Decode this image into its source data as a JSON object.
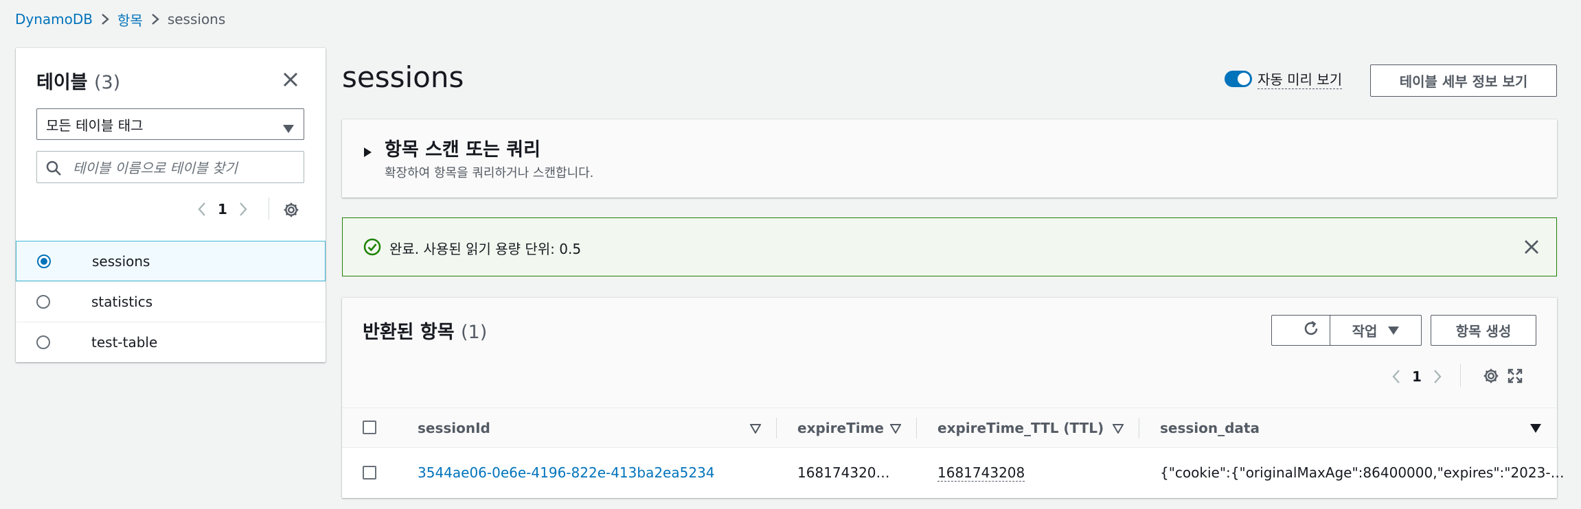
{
  "breadcrumb": {
    "root": "DynamoDB",
    "items": "항목",
    "current": "sessions"
  },
  "left_panel": {
    "title": "테이블",
    "count": "(3)",
    "tag_filter": "모든 테이블 태그",
    "search_placeholder": "테이블 이름으로 테이블 찾기",
    "page": "1",
    "tables": [
      {
        "name": "sessions",
        "selected": true
      },
      {
        "name": "statistics",
        "selected": false
      },
      {
        "name": "test-table",
        "selected": false
      }
    ]
  },
  "main": {
    "title": "sessions",
    "auto_preview_label": "자동 미리 보기",
    "details_button": "테이블 세부 정보 보기",
    "scan": {
      "title": "항목 스캔 또는 쿼리",
      "subtitle": "확장하여 항목을 쿼리하거나 스캔합니다."
    },
    "flash": {
      "message": "완료. 사용된 읽기 용량 단위: 0.5"
    },
    "results": {
      "title": "반환된 항목",
      "count": "(1)",
      "actions_button": "작업",
      "create_button": "항목 생성",
      "page": "1",
      "columns": [
        "sessionId",
        "expireTime",
        "expireTime_TTL (TTL)",
        "session_data"
      ],
      "rows": [
        {
          "sessionId": "3544ae06-0e6e-4196-822e-413ba2ea5234",
          "expireTime": "168174320…",
          "expireTime_TTL": "1681743208",
          "session_data": "{\"cookie\":{\"originalMaxAge\":86400000,\"expires\":\"2023-…"
        }
      ]
    }
  },
  "colors": {
    "link": "#0073bb",
    "success": "#1d8102",
    "background": "#f2f3f3"
  }
}
